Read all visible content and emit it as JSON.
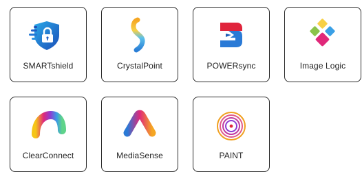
{
  "apps": [
    {
      "label": "SMARTshield",
      "icon": "shield-lock-icon"
    },
    {
      "label": "CrystalPoint",
      "icon": "crystal-s-icon"
    },
    {
      "label": "POWERsync",
      "icon": "powersync-s-icon"
    },
    {
      "label": "Image Logic",
      "icon": "diamond-grid-icon"
    },
    {
      "label": "ClearConnect",
      "icon": "rainbow-arc-icon"
    },
    {
      "label": "MediaSense",
      "icon": "chevron-a-icon"
    },
    {
      "label": "PAINT",
      "icon": "concentric-circles-icon"
    }
  ]
}
